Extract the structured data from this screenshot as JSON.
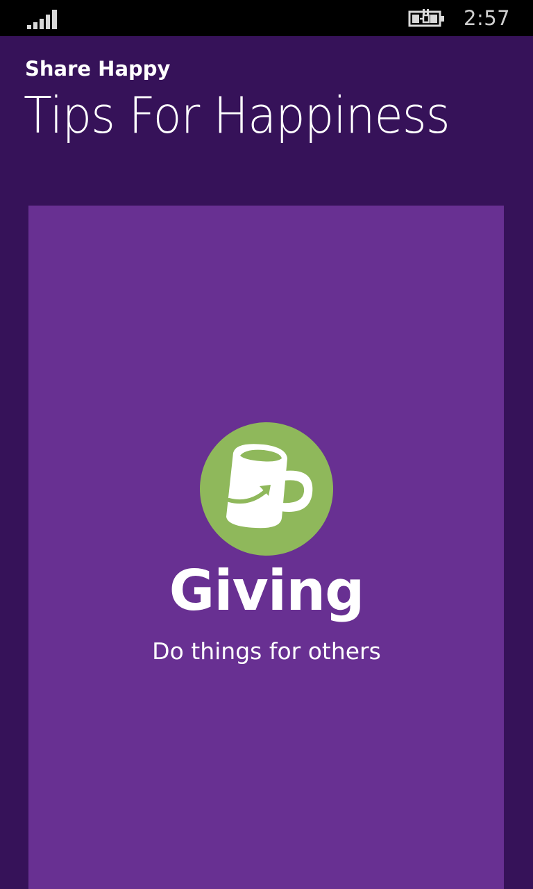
{
  "status_bar": {
    "time": "2:57",
    "signal_icon": "signal-strength-icon",
    "battery_icon": "battery-charging-icon"
  },
  "header": {
    "app_name": "Share Happy",
    "page_title": "Tips For Happiness"
  },
  "tip": {
    "icon": "mug-icon",
    "title": "Giving",
    "subtitle": "Do things for others"
  },
  "colors": {
    "status_bar": "#000000",
    "background": "#361259",
    "card": "#683092",
    "icon_circle": "#8fb85b",
    "text": "#ffffff",
    "clock_text": "#cfcfcf"
  }
}
